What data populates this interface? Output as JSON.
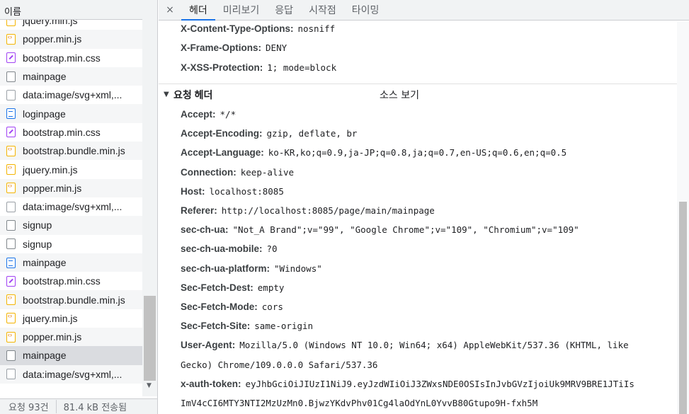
{
  "network_list": {
    "column_header": "이름",
    "files": [
      {
        "name": "jquery.min.js",
        "type": "js"
      },
      {
        "name": "popper.min.js",
        "type": "js"
      },
      {
        "name": "bootstrap.min.css",
        "type": "css"
      },
      {
        "name": "mainpage",
        "type": "doc"
      },
      {
        "name": "data:image/svg+xml,...",
        "type": "blank"
      },
      {
        "name": "loginpage",
        "type": "html"
      },
      {
        "name": "bootstrap.min.css",
        "type": "css"
      },
      {
        "name": "bootstrap.bundle.min.js",
        "type": "js"
      },
      {
        "name": "jquery.min.js",
        "type": "js"
      },
      {
        "name": "popper.min.js",
        "type": "js"
      },
      {
        "name": "data:image/svg+xml,...",
        "type": "blank"
      },
      {
        "name": "signup",
        "type": "doc"
      },
      {
        "name": "signup",
        "type": "doc"
      },
      {
        "name": "mainpage",
        "type": "html"
      },
      {
        "name": "bootstrap.min.css",
        "type": "css"
      },
      {
        "name": "bootstrap.bundle.min.js",
        "type": "js"
      },
      {
        "name": "jquery.min.js",
        "type": "js"
      },
      {
        "name": "popper.min.js",
        "type": "js"
      },
      {
        "name": "mainpage",
        "type": "doc",
        "selected": true
      },
      {
        "name": "data:image/svg+xml,...",
        "type": "blank"
      }
    ]
  },
  "status_bar": {
    "requests": "요청 93건",
    "transferred": "81.4 kB 전송됨"
  },
  "tabs": {
    "close_symbol": "×",
    "items": [
      "헤더",
      "미리보기",
      "응답",
      "시작점",
      "타이밍"
    ],
    "active": "헤더"
  },
  "response_headers": [
    {
      "key": "X-Content-Type-Options:",
      "value": "nosniff"
    },
    {
      "key": "X-Frame-Options:",
      "value": "DENY"
    },
    {
      "key": "X-XSS-Protection:",
      "value": "1; mode=block"
    }
  ],
  "request_section": {
    "title": "요청 헤더",
    "view_source": "소스 보기"
  },
  "request_headers": [
    {
      "key": "Accept:",
      "value": "*/*"
    },
    {
      "key": "Accept-Encoding:",
      "value": "gzip, deflate, br"
    },
    {
      "key": "Accept-Language:",
      "value": "ko-KR,ko;q=0.9,ja-JP;q=0.8,ja;q=0.7,en-US;q=0.6,en;q=0.5"
    },
    {
      "key": "Connection:",
      "value": "keep-alive"
    },
    {
      "key": "Host:",
      "value": "localhost:8085"
    },
    {
      "key": "Referer:",
      "value": "http://localhost:8085/page/main/mainpage"
    },
    {
      "key": "sec-ch-ua:",
      "value": "\"Not_A Brand\";v=\"99\", \"Google Chrome\";v=\"109\", \"Chromium\";v=\"109\""
    },
    {
      "key": "sec-ch-ua-mobile:",
      "value": "?0"
    },
    {
      "key": "sec-ch-ua-platform:",
      "value": "\"Windows\""
    },
    {
      "key": "Sec-Fetch-Dest:",
      "value": "empty"
    },
    {
      "key": "Sec-Fetch-Mode:",
      "value": "cors"
    },
    {
      "key": "Sec-Fetch-Site:",
      "value": "same-origin"
    },
    {
      "key": "User-Agent:",
      "value": "Mozilla/5.0 (Windows NT 10.0; Win64; x64) AppleWebKit/537.36 (KHTML, like",
      "value_cont": "Gecko) Chrome/109.0.0.0 Safari/537.36"
    },
    {
      "key": "x-auth-token:",
      "value": "eyJhbGciOiJIUzI1NiJ9.eyJzdWIiOiJ3ZWxsNDE0OSIsInJvbGVzIjoiUk9MRV9BRE1JTiIs",
      "value_cont": "ImV4cCI6MTY3NTI2MzUzMn0.BjwzYKdvPhv01Cg4laOdYnL0YvvB80Gtupo9H-fxh5M"
    }
  ]
}
